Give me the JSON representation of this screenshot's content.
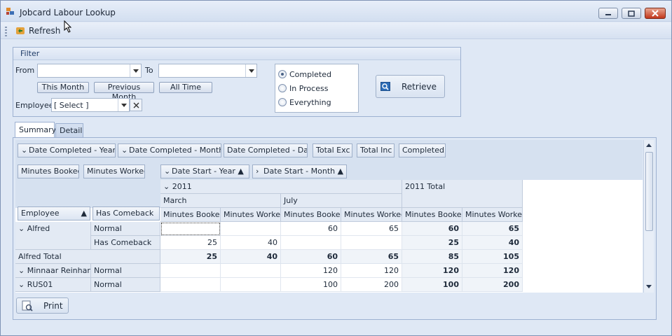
{
  "window": {
    "title": "Jobcard Labour Lookup"
  },
  "toolbar": {
    "refresh_label": "Refresh"
  },
  "filter": {
    "group_title": "Filter",
    "from_label": "From",
    "from_value": "",
    "to_label": "To",
    "to_value": "",
    "this_month_label": "This Month",
    "previous_month_label": "Previous Month",
    "all_time_label": "All Time",
    "employee_label": "Employee",
    "employee_value": "[ Select ]",
    "status_options": [
      {
        "label": "Completed",
        "selected": true
      },
      {
        "label": "In Process",
        "selected": false
      },
      {
        "label": "Everything",
        "selected": false
      }
    ],
    "retrieve_label": "Retrieve"
  },
  "tabs": [
    {
      "label": "Summary",
      "active": true
    },
    {
      "label": "Detail",
      "active": false
    }
  ],
  "pivot": {
    "filter_fields": [
      "Date Completed - Year",
      "Date Completed - Month",
      "Date Completed - Day",
      "Total Exc",
      "Total Inc",
      "Completed"
    ],
    "data_fields": [
      "Minutes Booked",
      "Minutes Worked"
    ],
    "column_fields": [
      "Date Start - Year",
      "Date Start - Month"
    ],
    "row_fields": [
      "Employee",
      "Has Comeback"
    ],
    "year": "2011",
    "year_total_label": "2011 Total",
    "months": [
      "March",
      "July"
    ],
    "measure_headers": [
      "Minutes Booked",
      "Minutes Worked",
      "Minutes Booked",
      "Minutes Worked",
      "Minutes Booked",
      "Minutes Worked"
    ],
    "rows": [
      {
        "employee": "Alfred",
        "sub": "Normal",
        "values": [
          "",
          "",
          "60",
          "65",
          "60",
          "65"
        ]
      },
      {
        "employee": "",
        "sub": "Has Comeback",
        "values": [
          "25",
          "40",
          "",
          "",
          "25",
          "40"
        ]
      },
      {
        "employee": "Alfred Total",
        "sub": "",
        "values": [
          "25",
          "40",
          "60",
          "65",
          "85",
          "105"
        ]
      },
      {
        "employee": "Minnaar Reinhard",
        "sub": "Normal",
        "values": [
          "",
          "",
          "120",
          "120",
          "120",
          "120"
        ]
      },
      {
        "employee": "RUS01",
        "sub": "Normal",
        "values": [
          "",
          "",
          "100",
          "200",
          "100",
          "200"
        ]
      }
    ]
  },
  "print_label": "Print",
  "colors": {
    "window_bg": "#dfe8f5",
    "header_bg": "#e3eaf4",
    "close_button": "#c1361c",
    "accent_blue": "#2c6db8"
  }
}
